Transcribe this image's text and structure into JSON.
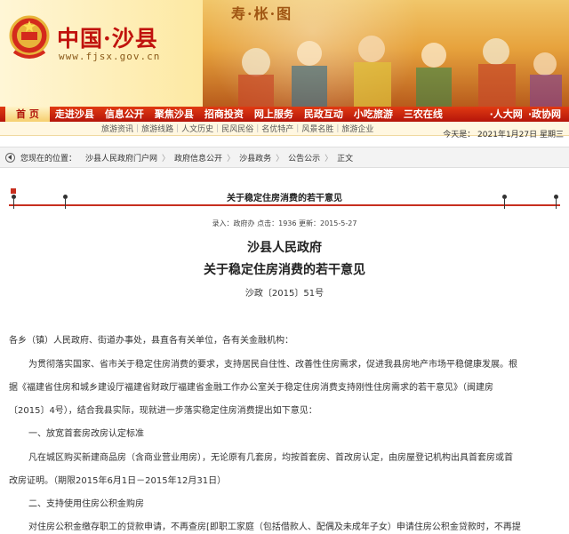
{
  "header": {
    "site_title": "中国·沙县",
    "site_url": "www.fjsx.gov.cn",
    "mural_caption": "寿·枨·图"
  },
  "nav": {
    "items": [
      "首 页",
      "走进沙县",
      "信息公开",
      "聚焦沙县",
      "招商投资",
      "网上服务",
      "民政互动",
      "小吃旅游",
      "三农在线"
    ],
    "extra": [
      "·人大网",
      "·政协网"
    ]
  },
  "subnav": {
    "items": [
      "旅游资讯",
      "旅游线路",
      "人文历史",
      "民风民俗",
      "名优特产",
      "风景名胜",
      "旅游企业"
    ]
  },
  "date_text": "今天是： 2021年1月27日 星期三",
  "breadcrumb": {
    "prefix": "您现在的位置：",
    "items": [
      "沙县人民政府门户网",
      "政府信息公开",
      "沙县政务",
      "公告公示",
      "正文"
    ]
  },
  "article": {
    "head_title": "关于稳定住房消费的若干意见",
    "meta": "录入：政府办  点击：1936  更新：2015-5-27",
    "org": "沙县人民政府",
    "title": "关于稳定住房消费的若干意见",
    "number": "沙政〔2015〕51号",
    "paragraphs": [
      "各乡（镇）人民政府、街道办事处，县直各有关单位，各有关金融机构：",
      "为贯彻落实国家、省市关于稳定住房消费的要求，支持居民自住性、改善性住房需求，促进我县房地产市场平稳健康发展。根",
      "据《福建省住房和城乡建设厅福建省财政厅福建省金融工作办公室关于稳定住房消费支持刚性住房需求的若干意见》（闽建房",
      "〔2015〕4号），结合我县实际，现就进一步落实稳定住房消费提出如下意见：",
      "一、放宽首套房改房认定标准",
      "凡在城区购买新建商品房（含商业营业用房），无论原有几套房，均按首套房、首改房认定，由房屋登记机构出具首套房或首",
      "改房证明。（期限2015年6月1日－2015年12月31日）",
      "二、支持使用住房公积金购房",
      "对住房公积金缴存职工的贷款申请，不再查房[即职工家庭（包括借款人、配偶及未成年子女）申请住房公积金贷款时，不再提"
    ]
  }
}
